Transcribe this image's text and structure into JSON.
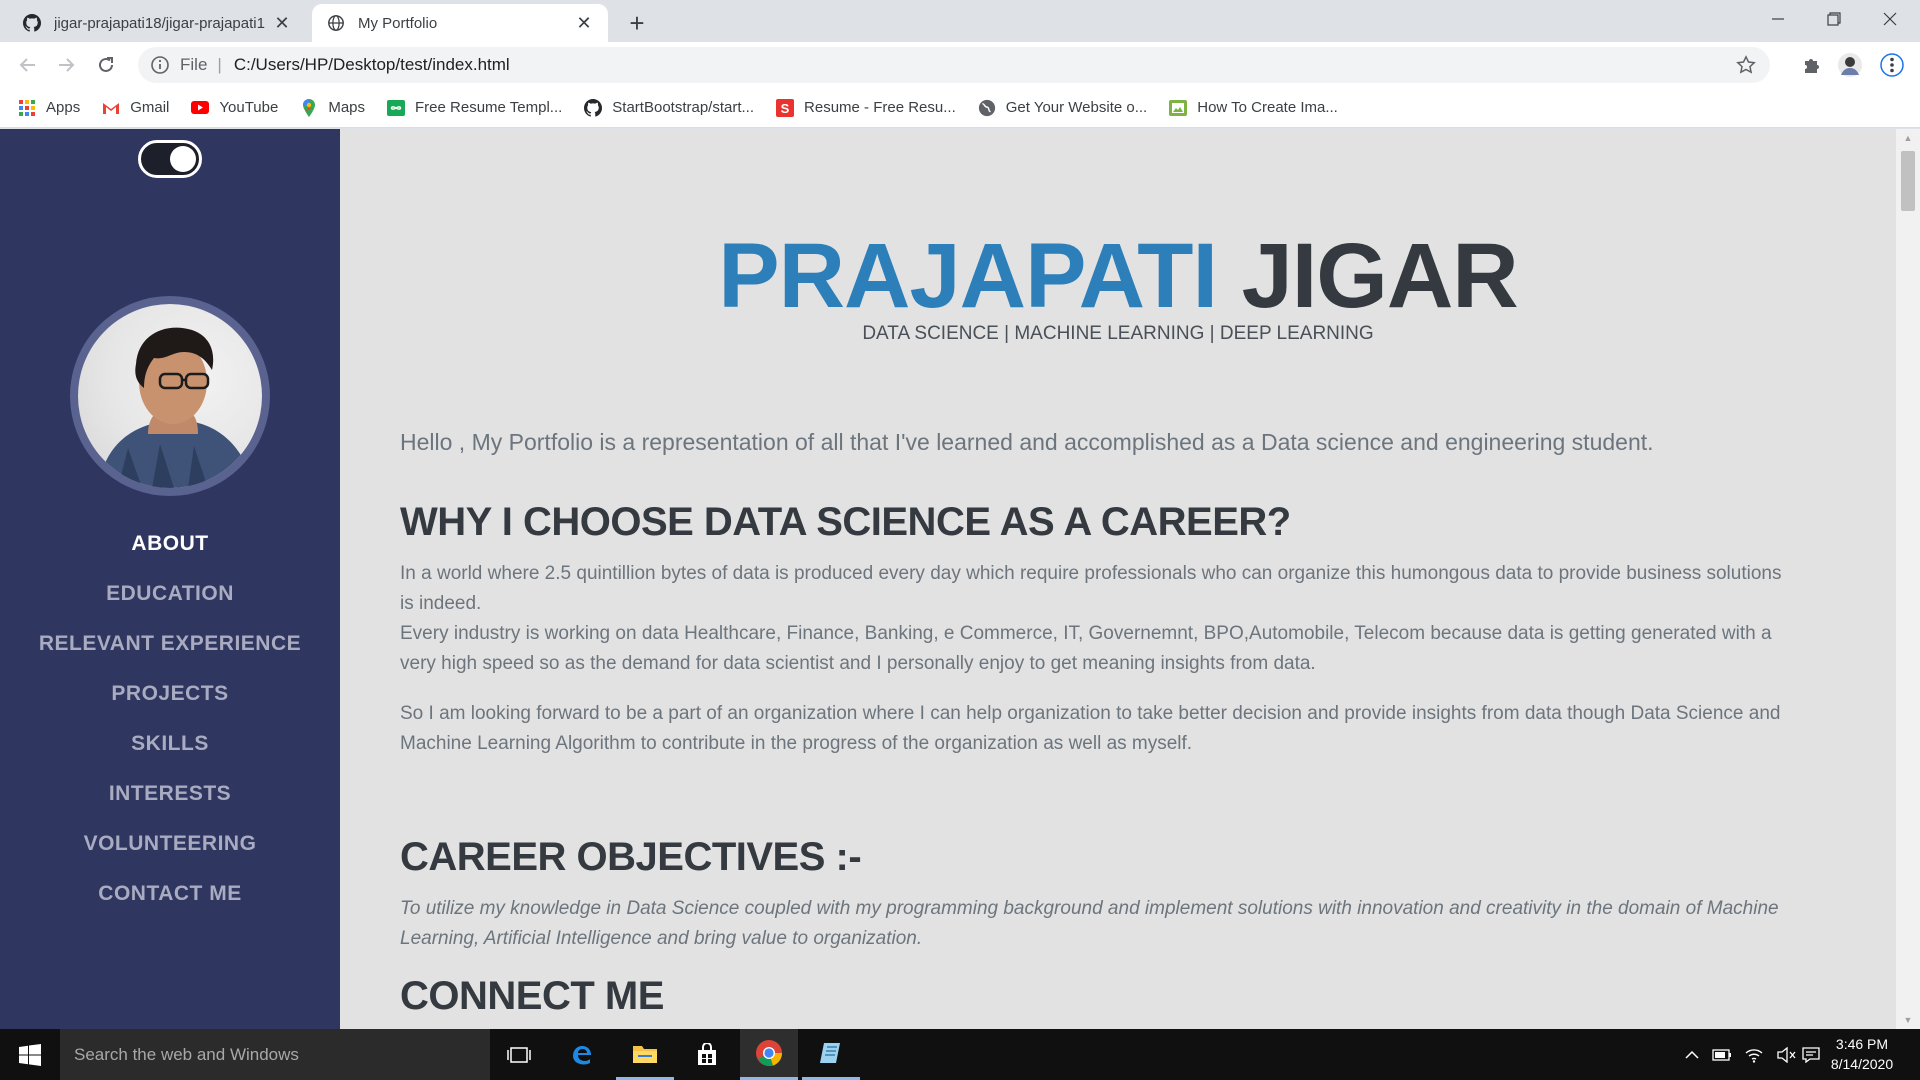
{
  "browser": {
    "tabs": [
      {
        "title": "jigar-prajapati18/jigar-prajapati1",
        "favicon": "github-icon",
        "active": false
      },
      {
        "title": "My Portfolio",
        "favicon": "globe-icon",
        "active": true
      }
    ],
    "address": {
      "scheme": "File",
      "url": "C:/Users/HP/Desktop/test/index.html"
    },
    "bookmarks": [
      {
        "label": "Apps",
        "icon": "apps-grid-icon"
      },
      {
        "label": "Gmail",
        "icon": "gmail-icon"
      },
      {
        "label": "YouTube",
        "icon": "youtube-icon"
      },
      {
        "label": "Maps",
        "icon": "maps-icon"
      },
      {
        "label": "Free Resume Templ...",
        "icon": "infinity-icon"
      },
      {
        "label": "StartBootstrap/start...",
        "icon": "github-icon"
      },
      {
        "label": "Resume - Free Resu...",
        "icon": "s-logo-icon"
      },
      {
        "label": "Get Your Website o...",
        "icon": "globe-icon"
      },
      {
        "label": "How To Create Ima...",
        "icon": "image-icon"
      }
    ]
  },
  "sidebar": {
    "nav": [
      {
        "label": "ABOUT",
        "active": true
      },
      {
        "label": "EDUCATION"
      },
      {
        "label": "RELEVANT EXPERIENCE"
      },
      {
        "label": "PROJECTS"
      },
      {
        "label": "SKILLS"
      },
      {
        "label": "INTERESTS"
      },
      {
        "label": "VOLUNTEERING"
      },
      {
        "label": "CONTACT ME"
      }
    ]
  },
  "main": {
    "first_name": "PRAJAPATI",
    "last_name": "JIGAR",
    "subtitle": "DATA SCIENCE | MACHINE LEARNING | DEEP LEARNING",
    "lead": "Hello , My Portfolio is a representation of all that I've learned and accomplished as a Data science and engineering student.",
    "why_heading": "WHY I CHOOSE DATA SCIENCE AS A CAREER?",
    "why_p1_line1": "In a world where 2.5 quintillion bytes of data is produced every day which require professionals who can organize this humongous data to provide business solutions is indeed.",
    "why_p1_line2": "Every industry is working on data Healthcare, Finance, Banking, e Commerce, IT, Governemnt, BPO,Automobile, Telecom because data is getting generated with a very high speed so as the demand for data scientist and I personally enjoy to get meaning insights from data.",
    "why_p2": "So I am looking forward to be a part of an organization where I can help organization to take better decision and provide insights from data though Data Science and Machine Learning Algorithm to contribute in the progress of the organization as well as myself.",
    "career_heading": "CAREER OBJECTIVES :-",
    "career_p": "To utilize my knowledge in Data Science coupled with my programming background and implement solutions with innovation and creativity in the domain of Machine Learning, Artificial Intelligence and bring value to organization.",
    "connect_heading": "CONNECT ME"
  },
  "taskbar": {
    "search_placeholder": "Search the web and Windows",
    "time": "3:46 PM",
    "date": "8/14/2020"
  },
  "colors": {
    "sidebar_bg": "#2f3660",
    "accent_blue": "#2d7fba",
    "heading_dark": "#343a40",
    "page_bg": "#e2e2e2"
  }
}
